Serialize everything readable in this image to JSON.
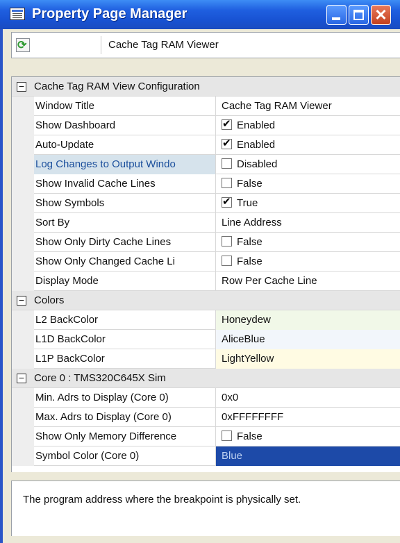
{
  "window": {
    "title": "Property Page Manager",
    "minimize_icon": "minimize-icon",
    "maximize_icon": "maximize-icon",
    "close_icon": "close-icon",
    "close_glyph": "✕"
  },
  "toolbar": {
    "refresh_icon": "refresh-icon",
    "refresh_glyph": "⟳",
    "object_name": "Cache Tag RAM Viewer"
  },
  "categories": {
    "config": "Cache Tag RAM View Configuration",
    "colors": "Colors",
    "core0": "Core 0 : TMS320C645X Sim"
  },
  "properties": {
    "window_title": {
      "name": "Window Title",
      "value": "Cache Tag RAM Viewer"
    },
    "show_dashboard": {
      "name": "Show Dashboard",
      "value": "Enabled",
      "checked": true
    },
    "auto_update": {
      "name": "Auto-Update",
      "value": "Enabled",
      "checked": true
    },
    "log_changes": {
      "name": "Log Changes to Output Windo",
      "value": "Disabled",
      "checked": false
    },
    "show_invalid": {
      "name": "Show Invalid Cache Lines",
      "value": "False",
      "checked": false
    },
    "show_symbols": {
      "name": "Show Symbols",
      "value": "True",
      "checked": true
    },
    "sort_by": {
      "name": "Sort By",
      "value": "Line Address"
    },
    "show_dirty": {
      "name": "Show Only Dirty Cache Lines",
      "value": "False",
      "checked": false
    },
    "show_changed": {
      "name": "Show Only Changed Cache Li",
      "value": "False",
      "checked": false
    },
    "display_mode": {
      "name": "Display Mode",
      "value": "Row Per Cache Line"
    },
    "l2_backcolor": {
      "name": "L2 BackColor",
      "value": "Honeydew",
      "color": "#f1f8e8"
    },
    "l1d_backcolor": {
      "name": "L1D BackColor",
      "value": "AliceBlue",
      "color": "#f2f6fb"
    },
    "l1p_backcolor": {
      "name": "L1P BackColor",
      "value": "LightYellow",
      "color": "#fffbe3"
    },
    "min_adrs": {
      "name": "Min. Adrs to Display (Core 0)",
      "value": "0x0"
    },
    "max_adrs": {
      "name": "Max. Adrs to Display (Core 0)",
      "value": "0xFFFFFFFF"
    },
    "show_mem_diff": {
      "name": "Show Only  Memory Difference",
      "value": "False",
      "checked": false
    },
    "symbol_color": {
      "name": "Symbol Color (Core 0)",
      "value": "Blue",
      "color": "#1d4aa8"
    }
  },
  "description": "The program address where the breakpoint is physically set."
}
